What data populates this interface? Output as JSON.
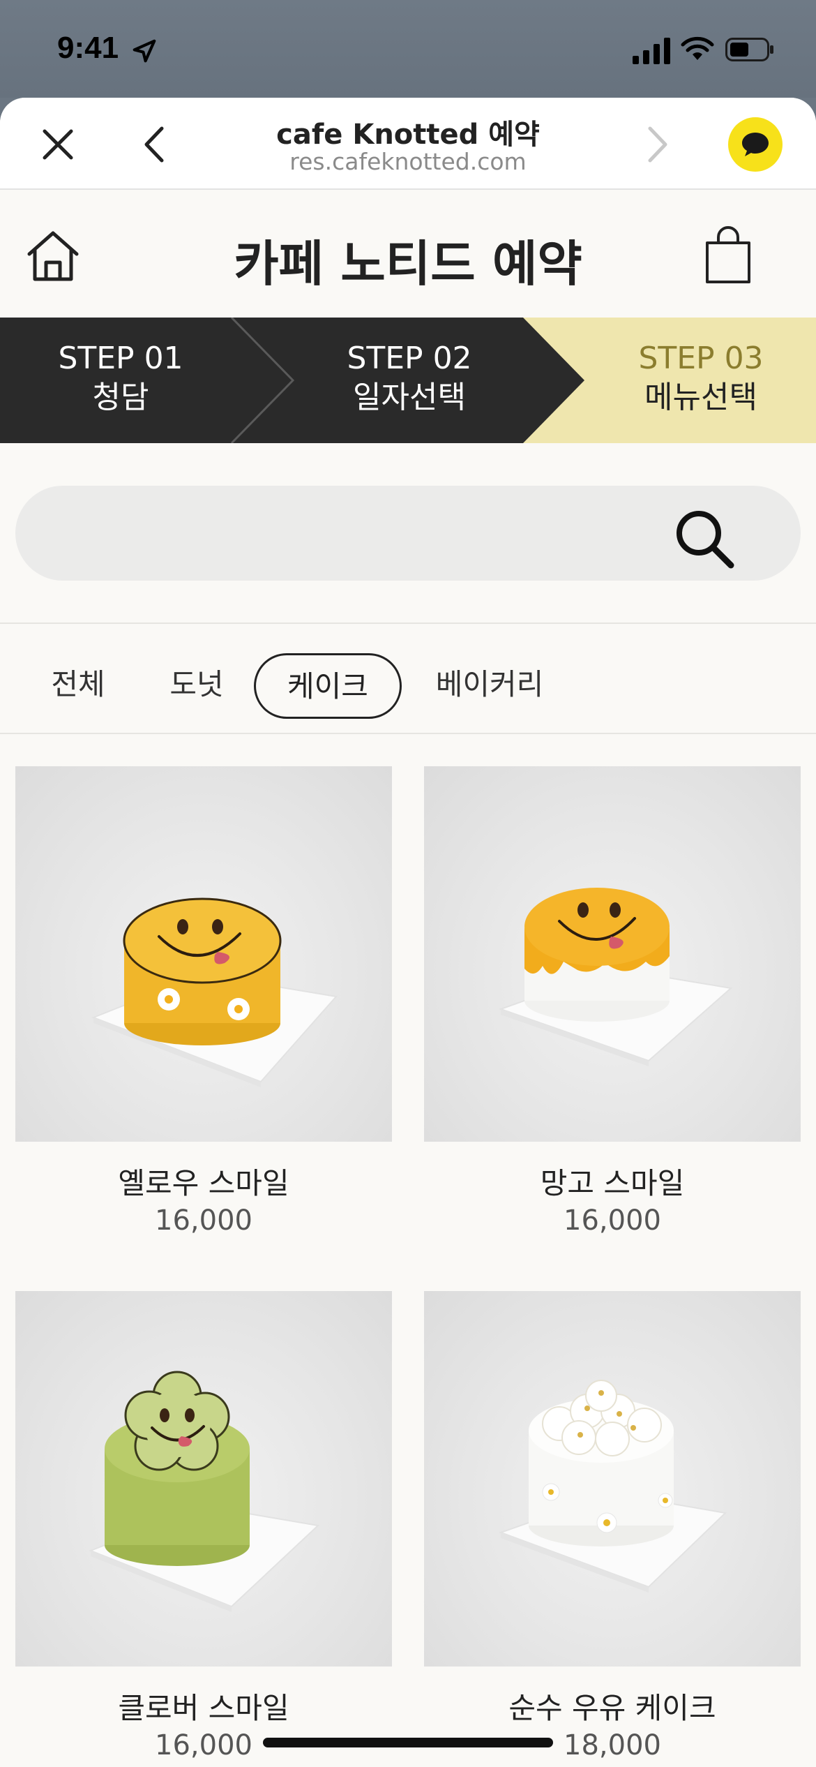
{
  "status_bar": {
    "time": "9:41"
  },
  "browser": {
    "title": "cafe Knotted 예약",
    "url": "res.cafeknotted.com"
  },
  "header": {
    "title": "카페 노티드 예약"
  },
  "steps": [
    {
      "number": "STEP 01",
      "name": "청담",
      "active": false
    },
    {
      "number": "STEP 02",
      "name": "일자선택",
      "active": false
    },
    {
      "number": "STEP 03",
      "name": "메뉴선택",
      "active": true
    }
  ],
  "search": {
    "placeholder": ""
  },
  "categories": [
    {
      "label": "전체",
      "selected": false
    },
    {
      "label": "도넛",
      "selected": false
    },
    {
      "label": "케이크",
      "selected": true
    },
    {
      "label": "베이커리",
      "selected": false
    }
  ],
  "products": [
    {
      "name": "옐로우 스마일",
      "price": "16,000"
    },
    {
      "name": "망고 스마일",
      "price": "16,000"
    },
    {
      "name": "클로버 스마일",
      "price": "16,000"
    },
    {
      "name": "순수 우유 케이크",
      "price": "18,000"
    }
  ],
  "colors": {
    "step_dark": "#2a2a2a",
    "step_active_bg": "#efe6ae",
    "step_active_number": "#8b7d2e",
    "kakao_yellow": "#f7e11a",
    "page_bg": "#faf9f6"
  }
}
